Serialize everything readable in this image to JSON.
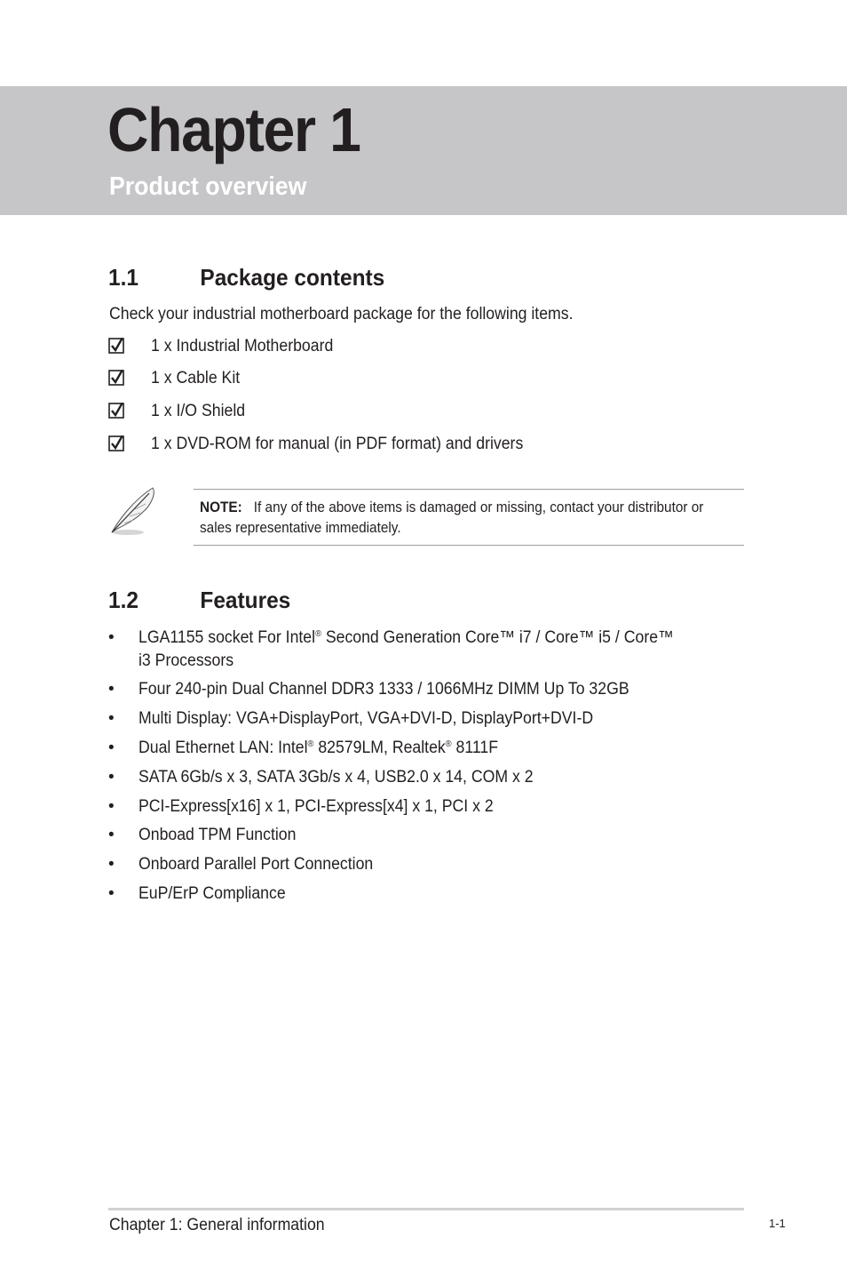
{
  "header": {
    "chapter_title": "Chapter 1",
    "chapter_subtitle": "Product overview"
  },
  "section_1": {
    "number": "1.1",
    "title": "Package contents",
    "intro": "Check your industrial motherboard package for the following items.",
    "items": [
      {
        "label": "1 x Industrial Motherboard",
        "checked": true
      },
      {
        "label": "1 x Cable Kit",
        "checked": true
      },
      {
        "label": "1 x I/O Shield",
        "checked": true
      },
      {
        "label": "1 x DVD-ROM for manual (in PDF format) and drivers",
        "checked": true
      }
    ],
    "note": {
      "label": "NOTE:",
      "text": "If any of the above items is damaged or missing, contact your distributor or sales representative immediately."
    }
  },
  "section_2": {
    "number": "1.2",
    "title": "Features",
    "bullet": "•",
    "features": [
      {
        "parts": [
          "LGA1155 socket For Intel",
          "®",
          " Second Generation Core™ i7 / Core™ i5 / Core™"
        ],
        "line2": "i3 Processors"
      },
      {
        "parts": [
          "Four 240-pin Dual Channel DDR3 1333 / 1066MHz DIMM Up To 32GB"
        ]
      },
      {
        "parts": [
          "Multi Display: VGA+DisplayPort, VGA+DVI-D, DisplayPort+DVI-D"
        ]
      },
      {
        "parts": [
          "Dual Ethernet LAN: Intel",
          "®",
          " 82579LM, Realtek",
          "®",
          " 8111F"
        ]
      },
      {
        "parts": [
          "SATA 6Gb/s x 3, SATA 3Gb/s x 4, USB2.0 x 14, COM x 2"
        ]
      },
      {
        "parts": [
          "PCI-Express[x16] x 1, PCI-Express[x4] x 1, PCI x 2"
        ]
      },
      {
        "parts": [
          "Onboad TPM Function"
        ]
      },
      {
        "parts": [
          "Onboard Parallel Port Connection"
        ]
      },
      {
        "parts": [
          "EuP/ErP Compliance"
        ]
      }
    ]
  },
  "footer": {
    "left": "Chapter 1: General information",
    "page_number": "1-1"
  }
}
